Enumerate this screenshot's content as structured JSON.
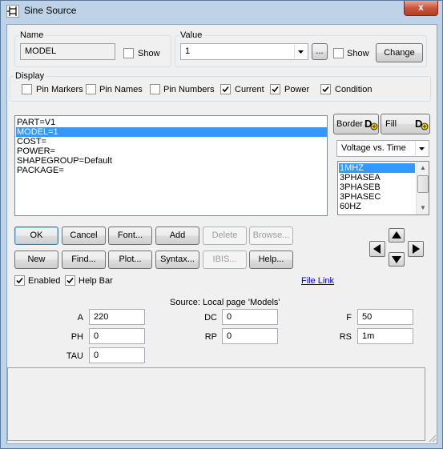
{
  "window": {
    "title": "Sine Source",
    "close_glyph": "x"
  },
  "name_group": {
    "legend": "Name",
    "value": "MODEL",
    "show_label": "Show",
    "show_checked": false
  },
  "value_group": {
    "legend": "Value",
    "value": "1",
    "browse_label": "...",
    "show_label": "Show",
    "show_checked": false,
    "change_label": "Change"
  },
  "display_group": {
    "legend": "Display",
    "options": [
      {
        "label": "Pin Markers",
        "checked": false
      },
      {
        "label": "Pin Names",
        "checked": false
      },
      {
        "label": "Pin Numbers",
        "checked": false
      },
      {
        "label": "Current",
        "checked": true
      },
      {
        "label": "Power",
        "checked": true
      },
      {
        "label": "Condition",
        "checked": true
      }
    ]
  },
  "attributes": {
    "items": [
      "PART=V1",
      "MODEL=1",
      "COST=",
      "POWER=",
      "SHAPEGROUP=Default",
      "PACKAGE="
    ],
    "selected_index": 1
  },
  "style_buttons": {
    "border_label": "Border",
    "fill_label": "Fill",
    "icon_glyph": "D"
  },
  "plot_select": {
    "value": "Voltage vs. Time"
  },
  "models": {
    "items": [
      "1MHZ",
      "3PHASEA",
      "3PHASEB",
      "3PHASEC",
      "60HZ"
    ],
    "selected_index": 0
  },
  "buttons": {
    "ok": "OK",
    "cancel": "Cancel",
    "font": "Font...",
    "add": "Add",
    "delete": "Delete",
    "browse": "Browse...",
    "new": "New",
    "find": "Find...",
    "plot": "Plot...",
    "syntax": "Syntax...",
    "ibis": "IBIS...",
    "help": "Help..."
  },
  "options": {
    "enabled_label": "Enabled",
    "enabled_checked": true,
    "helpbar_label": "Help Bar",
    "helpbar_checked": true,
    "file_link": "File Link"
  },
  "source_label": "Source: Local page 'Models'",
  "params": {
    "A": {
      "label": "A",
      "value": "220"
    },
    "DC": {
      "label": "DC",
      "value": "0"
    },
    "F": {
      "label": "F",
      "value": "50"
    },
    "PH": {
      "label": "PH",
      "value": "0"
    },
    "RP": {
      "label": "RP",
      "value": "0"
    },
    "RS": {
      "label": "RS",
      "value": "1m"
    },
    "TAU": {
      "label": "TAU",
      "value": "0"
    }
  },
  "help_bar": {
    "text": ""
  },
  "colors": {
    "selection": "#3399ff",
    "link": "#0000cc",
    "frame": "#bfd3e8",
    "close": "#c8553f"
  },
  "icons": [
    "app-icon",
    "close-icon",
    "dropdown-arrow-icon",
    "checkmark-icon",
    "border-style-icon",
    "fill-style-icon",
    "scroll-up-icon",
    "scroll-down-icon",
    "arrow-up-icon",
    "arrow-down-icon",
    "arrow-left-icon",
    "arrow-right-icon"
  ]
}
